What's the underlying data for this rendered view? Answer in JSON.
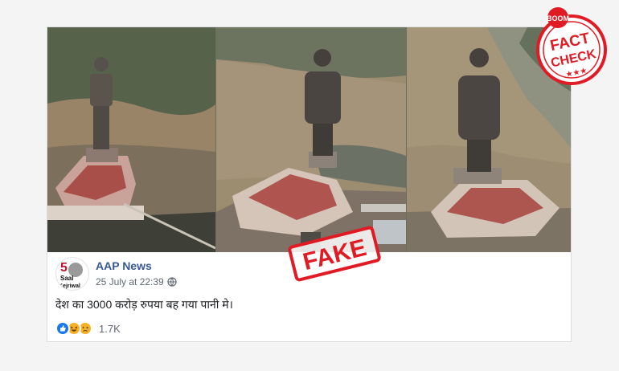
{
  "post": {
    "page_name": "AAP News",
    "timestamp": "25 July at 22:39",
    "text": "देश का 3000 करोड़ रुपया बह गया पानी मे।",
    "reaction_count": "1.7K",
    "avatar_number": "5",
    "avatar_caption": "Saal",
    "avatar_subcaption": "Kejriwal"
  },
  "stamps": {
    "fake_label": "FAKE",
    "badge_brand": "BOOM",
    "badge_line1": "FACT",
    "badge_line2": "CHECK",
    "badge_stars": "★★★"
  },
  "icons": {
    "globe": "globe-icon",
    "like": "like-reaction-icon",
    "haha": "haha-reaction-icon",
    "sad": "sad-reaction-icon"
  },
  "colors": {
    "stamp_red": "#e01b24",
    "link_blue": "#385898",
    "like_blue": "#1877f2",
    "emoji_yellow": "#f7b125"
  }
}
